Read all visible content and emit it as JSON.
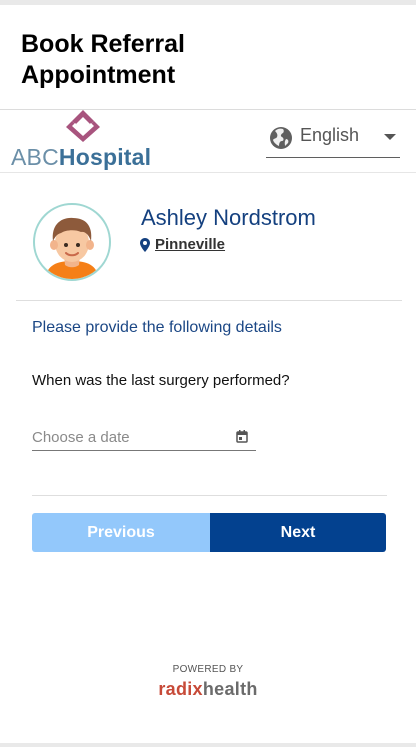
{
  "header": {
    "title": "Book Referral Appointment"
  },
  "brand": {
    "logo_text_1": "ABC",
    "logo_text_2": "Hospital",
    "colors": {
      "logo_mark": "#a8547e",
      "logo_abc": "#6b8fa8",
      "logo_hospital": "#3b7098"
    }
  },
  "language": {
    "selected": "English",
    "icon": "globe-icon"
  },
  "patient": {
    "name": "Ashley Nordstrom",
    "location": "Pinneville",
    "location_icon": "map-pin-icon",
    "avatar_icon": "boy-avatar"
  },
  "form": {
    "prompt": "Please provide the following details",
    "question": "When was the last surgery performed?",
    "date_placeholder": "Choose a date",
    "date_value": "",
    "calendar_icon": "calendar-icon"
  },
  "buttons": {
    "previous": "Previous",
    "next": "Next"
  },
  "footer": {
    "powered_by": "POWERED BY",
    "brand_1": "radix",
    "brand_2": "health"
  },
  "colors": {
    "accent": "#03418f",
    "accent_light": "#93c8fb",
    "heading_blue": "#14407f"
  }
}
